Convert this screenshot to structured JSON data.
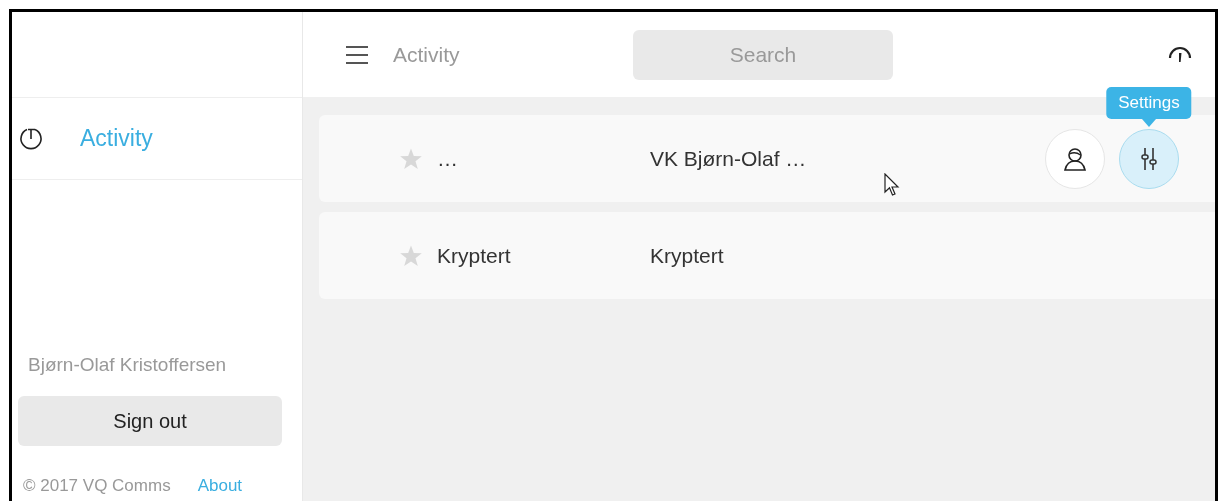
{
  "sidebar": {
    "items": [
      {
        "label": "Activity",
        "selected": true
      }
    ],
    "user_name": "Bjørn-Olaf Kristoffersen",
    "sign_out": "Sign out",
    "copyright": "© 2017 VQ Comms",
    "about": "About"
  },
  "header": {
    "title": "Activity",
    "search": {
      "placeholder": "Search"
    }
  },
  "rows": [
    {
      "starred": false,
      "name": "…",
      "subject": "VK Bjørn-Olaf …",
      "actions": [
        {
          "kind": "contact",
          "hovered": false
        },
        {
          "kind": "settings",
          "hovered": true,
          "tooltip": "Settings"
        }
      ]
    },
    {
      "starred": false,
      "name": "Kryptert",
      "subject": "Kryptert"
    }
  ]
}
